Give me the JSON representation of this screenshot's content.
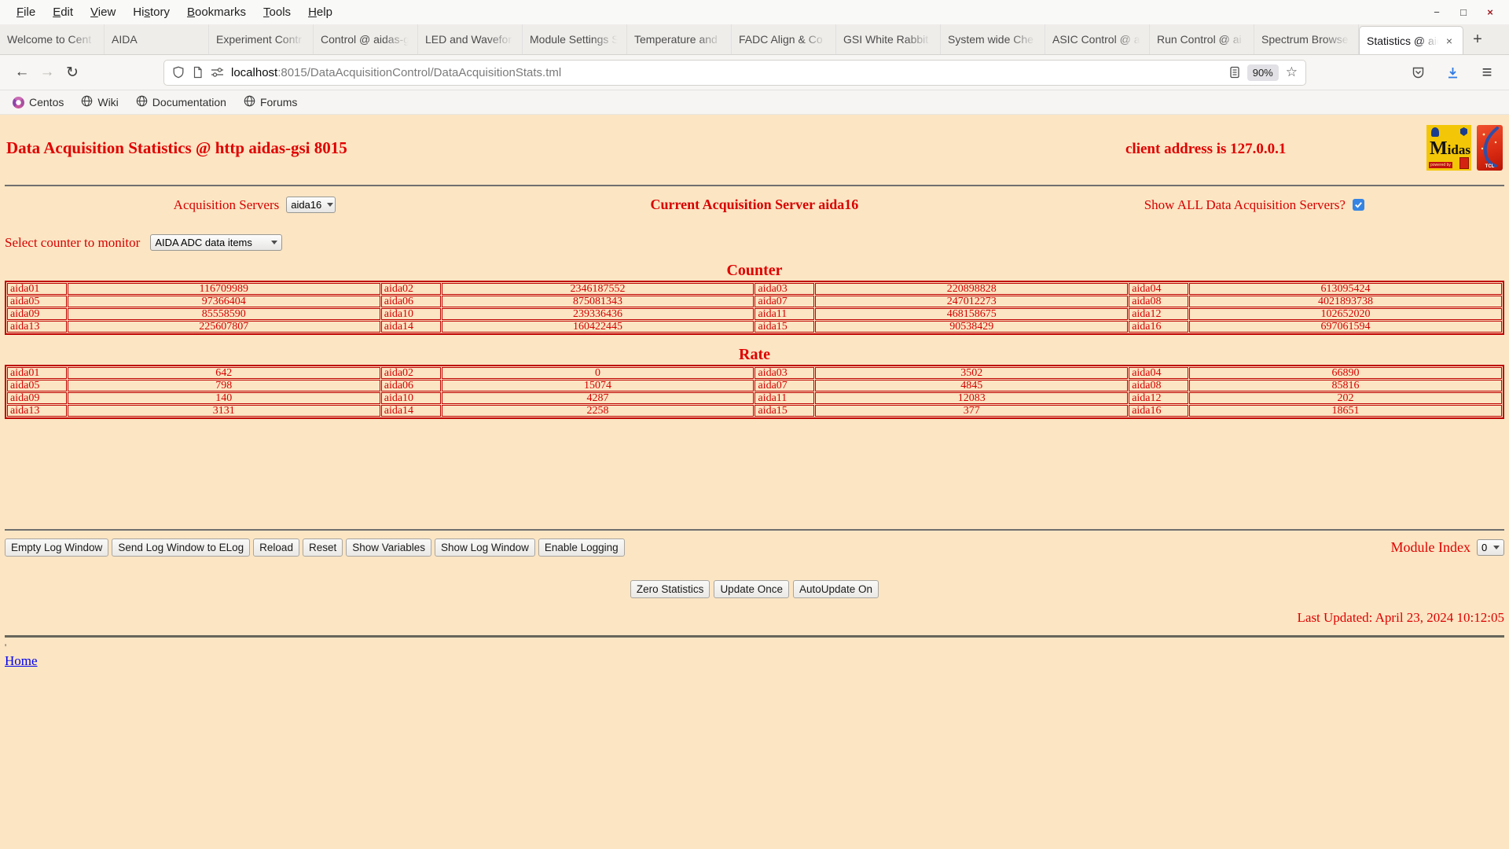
{
  "colors": {
    "page_background": "#fbe5c3",
    "accent_red": "#d40000",
    "table_border_red": "#bf0000",
    "link_blue": "#0000ee",
    "checkbox_blue": "#3584e4",
    "download_blue": "#2f7ae5"
  },
  "browser": {
    "menu": [
      {
        "label": "File",
        "u": 0
      },
      {
        "label": "Edit",
        "u": 0
      },
      {
        "label": "View",
        "u": 0
      },
      {
        "label": "History",
        "u": 2
      },
      {
        "label": "Bookmarks",
        "u": 0
      },
      {
        "label": "Tools",
        "u": 0
      },
      {
        "label": "Help",
        "u": 0
      }
    ],
    "window_controls": {
      "minimize": "−",
      "maximize": "□",
      "close": "×"
    },
    "tabs": [
      {
        "label": "Welcome to Cent",
        "active": false
      },
      {
        "label": "AIDA",
        "active": false
      },
      {
        "label": "Experiment Contr",
        "active": false
      },
      {
        "label": "Control @ aidas-g",
        "active": false
      },
      {
        "label": "LED and Wavefor",
        "active": false
      },
      {
        "label": "Module Settings S",
        "active": false
      },
      {
        "label": "Temperature and",
        "active": false
      },
      {
        "label": "FADC Align & Co",
        "active": false
      },
      {
        "label": "GSI White Rabbit",
        "active": false
      },
      {
        "label": "System wide Che",
        "active": false
      },
      {
        "label": "ASIC Control @ a",
        "active": false
      },
      {
        "label": "Run Control @ ai",
        "active": false
      },
      {
        "label": "Spectrum Browse",
        "active": false
      },
      {
        "label": "Statistics @ aid",
        "active": true
      }
    ],
    "tab_close_glyph": "×",
    "new_tab_glyph": "+",
    "nav": {
      "back": "←",
      "forward": "→",
      "reload": "↻",
      "hamburger": "≡",
      "star": "☆"
    },
    "urlbar": {
      "host": "localhost",
      "path": ":8015/DataAcquisitionControl/DataAcquisitionStats.tml",
      "zoom_level": "90%"
    },
    "bookmarks": [
      {
        "label": "Centos"
      },
      {
        "label": "Wiki"
      },
      {
        "label": "Documentation"
      },
      {
        "label": "Forums"
      }
    ]
  },
  "page": {
    "title": "Data Acquisition Statistics @ http aidas-gsi 8015",
    "client_address": "client address is 127.0.0.1",
    "logos": {
      "midas_label": "Midas",
      "midas_powered": "powered by",
      "tcl_label": "TCL"
    },
    "acq_servers_label": "Acquisition Servers",
    "acq_server_selected": "aida16",
    "current_server_text": "Current Acquisition Server aida16",
    "show_all_label": "Show ALL Data Acquisition Servers?",
    "counter_select_label": "Select counter to monitor",
    "counter_select_value": "AIDA ADC data items",
    "counter_heading": "Counter",
    "rate_heading": "Rate",
    "counter_rows": [
      [
        [
          "aida01",
          "116709989"
        ],
        [
          "aida02",
          "2346187552"
        ],
        [
          "aida03",
          "220898828"
        ],
        [
          "aida04",
          "613095424"
        ]
      ],
      [
        [
          "aida05",
          "97366404"
        ],
        [
          "aida06",
          "875081343"
        ],
        [
          "aida07",
          "247012273"
        ],
        [
          "aida08",
          "4021893738"
        ]
      ],
      [
        [
          "aida09",
          "85558590"
        ],
        [
          "aida10",
          "239336436"
        ],
        [
          "aida11",
          "468158675"
        ],
        [
          "aida12",
          "102652020"
        ]
      ],
      [
        [
          "aida13",
          "225607807"
        ],
        [
          "aida14",
          "160422445"
        ],
        [
          "aida15",
          "90538429"
        ],
        [
          "aida16",
          "697061594"
        ]
      ]
    ],
    "rate_rows": [
      [
        [
          "aida01",
          "642"
        ],
        [
          "aida02",
          "0"
        ],
        [
          "aida03",
          "3502"
        ],
        [
          "aida04",
          "66890"
        ]
      ],
      [
        [
          "aida05",
          "798"
        ],
        [
          "aida06",
          "15074"
        ],
        [
          "aida07",
          "4845"
        ],
        [
          "aida08",
          "85816"
        ]
      ],
      [
        [
          "aida09",
          "140"
        ],
        [
          "aida10",
          "4287"
        ],
        [
          "aida11",
          "12083"
        ],
        [
          "aida12",
          "202"
        ]
      ],
      [
        [
          "aida13",
          "3131"
        ],
        [
          "aida14",
          "2258"
        ],
        [
          "aida15",
          "377"
        ],
        [
          "aida16",
          "18651"
        ]
      ]
    ],
    "buttons_left": [
      "Empty Log Window",
      "Send Log Window to ELog",
      "Reload",
      "Reset",
      "Show Variables",
      "Show Log Window",
      "Enable Logging"
    ],
    "module_index_label": "Module Index",
    "module_index_value": "0",
    "buttons_center": [
      "Zero Statistics",
      "Update Once",
      "AutoUpdate On"
    ],
    "last_updated": "Last Updated: April 23, 2024 10:12:05",
    "stray_mark": "'",
    "home_link": "Home"
  }
}
